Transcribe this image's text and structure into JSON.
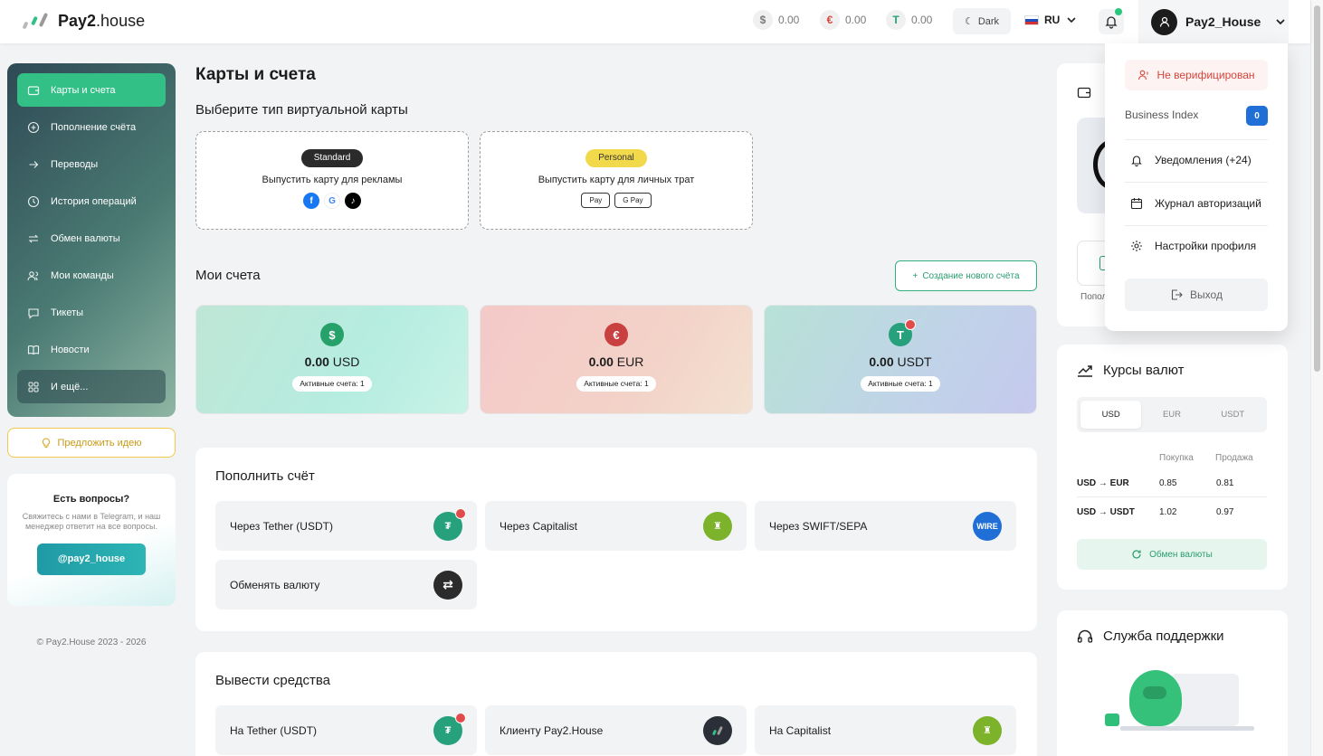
{
  "brand": {
    "name_bold": "Pay2",
    "name_rest": ".house"
  },
  "balances": [
    {
      "symbol": "$",
      "value": "0.00",
      "color": "#1c1c1c"
    },
    {
      "symbol": "€",
      "value": "0.00",
      "color": "#d8453b"
    },
    {
      "symbol": "T",
      "value": "0.00",
      "color": "#26a17b"
    }
  ],
  "theme_toggle": {
    "label": "Dark"
  },
  "language": {
    "code": "RU"
  },
  "user": {
    "name": "Pay2_House"
  },
  "sidebar": {
    "items": [
      {
        "label": "Карты и счета",
        "icon": "wallet-icon"
      },
      {
        "label": "Пополнение счёта",
        "icon": "plus-circle-icon"
      },
      {
        "label": "Переводы",
        "icon": "arrow-right-icon"
      },
      {
        "label": "История операций",
        "icon": "clock-icon"
      },
      {
        "label": "Обмен валюты",
        "icon": "exchange-icon"
      },
      {
        "label": "Мои команды",
        "icon": "users-icon"
      },
      {
        "label": "Тикеты",
        "icon": "chat-icon"
      },
      {
        "label": "Новости",
        "icon": "book-icon"
      },
      {
        "label": "И ещё...",
        "icon": "grid-icon"
      }
    ],
    "idea_button": "Предложить идею",
    "help": {
      "title": "Есть вопросы?",
      "text": "Свяжитесь с нами в Telegram, и наш менеджер ответит на все вопросы.",
      "button": "@pay2_house"
    },
    "copyright": "© Pay2.House 2023 - 2026"
  },
  "main": {
    "title": "Карты и счета",
    "virtual_cards_title": "Выберите тип виртуальной карты",
    "virtual_cards": [
      {
        "badge": "Standard",
        "text": "Выпустить карту для рекламы",
        "icons": [
          "facebook-icon",
          "google-icon",
          "tiktok-icon"
        ]
      },
      {
        "badge": "Personal",
        "text": "Выпустить карту для личных трат",
        "tags": [
          "Pay",
          "G Pay"
        ]
      }
    ],
    "accounts_title": "Мои счета",
    "create_account": "Создание нового счёта",
    "accounts": [
      {
        "symbol": "$",
        "amount": "0.00",
        "currency": "USD",
        "badge": "Активные счета: 1"
      },
      {
        "symbol": "€",
        "amount": "0.00",
        "currency": "EUR",
        "badge": "Активные счета: 1"
      },
      {
        "symbol": "T",
        "amount": "0.00",
        "currency": "USDT",
        "badge": "Активные счета: 1"
      }
    ],
    "topup": {
      "title": "Пополнить счёт",
      "options": [
        {
          "label": "Через Tether (USDT)",
          "icon": "tether-icon"
        },
        {
          "label": "Через Capitalist",
          "icon": "capitalist-icon"
        },
        {
          "label": "Через SWIFT/SEPA",
          "icon": "wire-icon",
          "icon_text": "WIRE"
        },
        {
          "label": "Обменять валюту",
          "icon": "swap-icon"
        }
      ]
    },
    "withdraw": {
      "title": "Вывести средства",
      "options": [
        {
          "label": "На Tether (USDT)",
          "icon": "tether-icon"
        },
        {
          "label": "Клиенту Pay2.House",
          "icon": "pay2house-icon"
        },
        {
          "label": "На Capitalist",
          "icon": "capitalist-icon"
        }
      ]
    }
  },
  "right": {
    "hidden_card_label": "Попол",
    "rates": {
      "title": "Курсы валют",
      "tabs": [
        "USD",
        "EUR",
        "USDT"
      ],
      "active_tab": "USD",
      "head_buy": "Покупка",
      "head_sell": "Продажа",
      "rows": [
        {
          "pair": "USD → EUR",
          "buy": "0.85",
          "sell": "0.81"
        },
        {
          "pair": "USD → USDT",
          "buy": "1.02",
          "sell": "0.97"
        }
      ],
      "exchange_button": "Обмен валюты"
    },
    "support": {
      "title": "Служба поддержки"
    }
  },
  "dropdown": {
    "unverified": "Не верифицирован",
    "business_index_label": "Business Index",
    "business_index_value": "0",
    "items": [
      {
        "label": "Уведомления (+24)",
        "icon": "bell-icon"
      },
      {
        "label": "Журнал авторизаций",
        "icon": "calendar-icon"
      },
      {
        "label": "Настройки профиля",
        "icon": "gear-icon"
      }
    ],
    "logout": "Выход"
  },
  "colors": {
    "accent": "#33c087",
    "tether": "#26a17b",
    "euro": "#c94040",
    "capitalist": "#7cb32a",
    "wire": "#1f6fd6"
  }
}
